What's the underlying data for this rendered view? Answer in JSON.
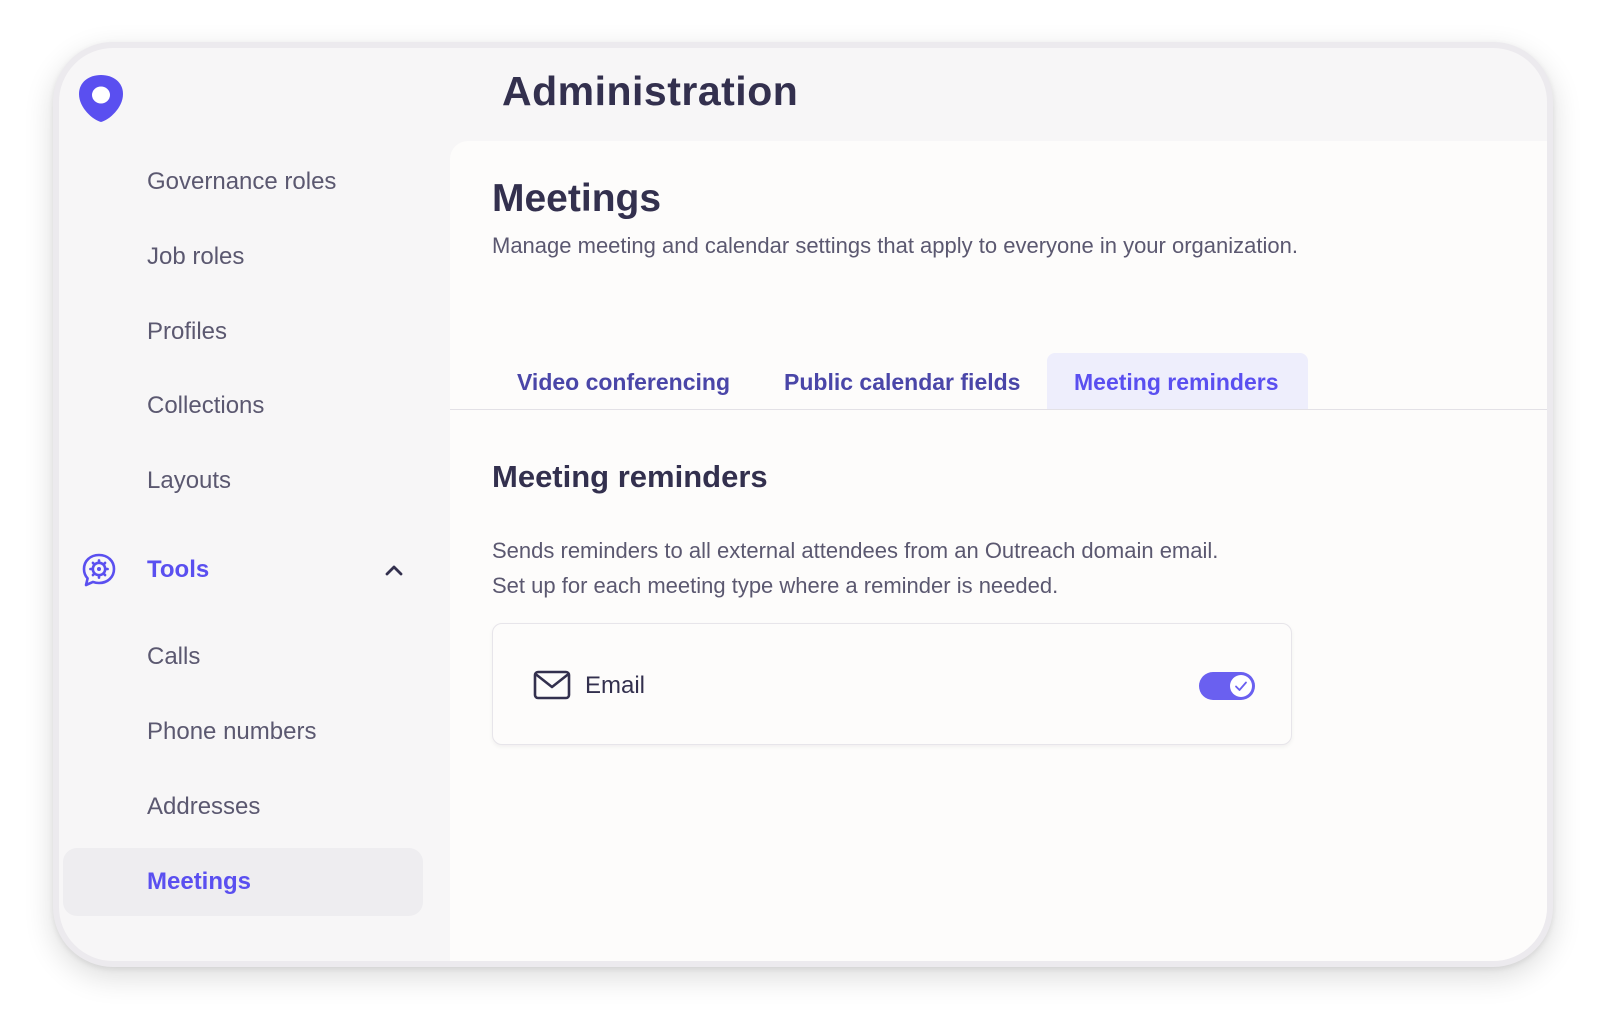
{
  "app": {
    "title": "Administration"
  },
  "sidebar": {
    "items": [
      {
        "label": "Governance roles"
      },
      {
        "label": "Job roles"
      },
      {
        "label": "Profiles"
      },
      {
        "label": "Collections"
      },
      {
        "label": "Layouts"
      }
    ],
    "group": {
      "label": "Tools",
      "icon": "gear-chat-icon",
      "expanded": true,
      "items": [
        {
          "label": "Calls"
        },
        {
          "label": "Phone numbers"
        },
        {
          "label": "Addresses"
        },
        {
          "label": "Meetings",
          "active": true
        }
      ]
    }
  },
  "page": {
    "title": "Meetings",
    "subtitle": "Manage meeting and calendar settings that apply to everyone in your organization."
  },
  "tabs": [
    {
      "label": "Video conferencing",
      "active": false
    },
    {
      "label": "Public calendar fields",
      "active": false
    },
    {
      "label": "Meeting reminders",
      "active": true
    }
  ],
  "section": {
    "title": "Meeting reminders",
    "description_line1": "Sends reminders to all external attendees from an Outreach domain email.",
    "description_line2": "Set up for each meeting type where a reminder is needed."
  },
  "reminder_card": {
    "icon": "mail-icon",
    "label": "Email",
    "enabled": true
  },
  "colors": {
    "accent": "#5a4ff0",
    "toggle_on": "#6a60f0",
    "heading": "#33304e",
    "body_text": "#5b5870",
    "active_tab_bg": "#eeeefc"
  }
}
